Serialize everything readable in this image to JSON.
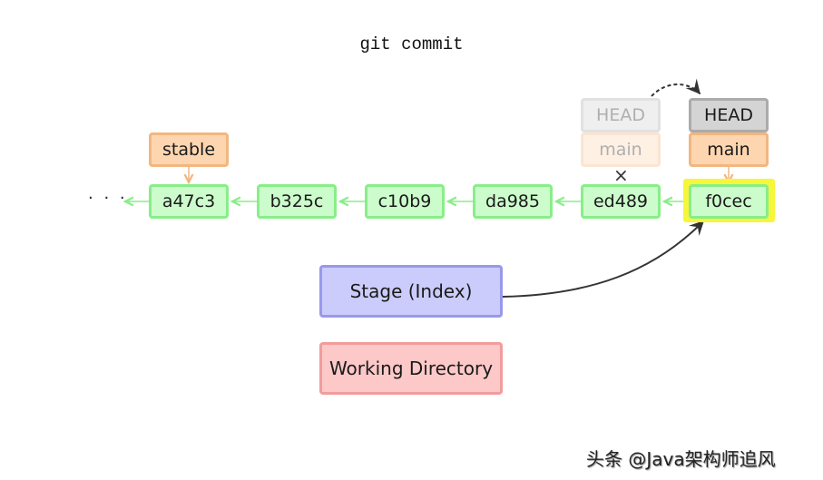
{
  "title": "git commit",
  "commits": [
    {
      "id": "a47c3"
    },
    {
      "id": "b325c"
    },
    {
      "id": "c10b9"
    },
    {
      "id": "da985"
    },
    {
      "id": "ed489"
    },
    {
      "id": "f0cec"
    }
  ],
  "ellipsis": "· · ·",
  "branches": {
    "stable": "stable",
    "main_old": "main",
    "main_new": "main",
    "head_old": "HEAD",
    "head_new": "HEAD"
  },
  "removed_marker": "×",
  "areas": {
    "stage": "Stage (Index)",
    "working": "Working Directory"
  },
  "colors": {
    "commit_fill": "#ccfccc",
    "commit_border": "#88ee88",
    "branch_fill": "#fdd6b0",
    "branch_border": "#f2b680",
    "head_fill": "#d4d4d4",
    "head_border": "#ababab",
    "stage_fill": "#ccccfc",
    "stage_border": "#9898ec",
    "working_fill": "#fcc8c8",
    "working_border": "#f29c9c",
    "highlight": "#f6f63a"
  },
  "watermark": "头条 @Java架构师追风"
}
